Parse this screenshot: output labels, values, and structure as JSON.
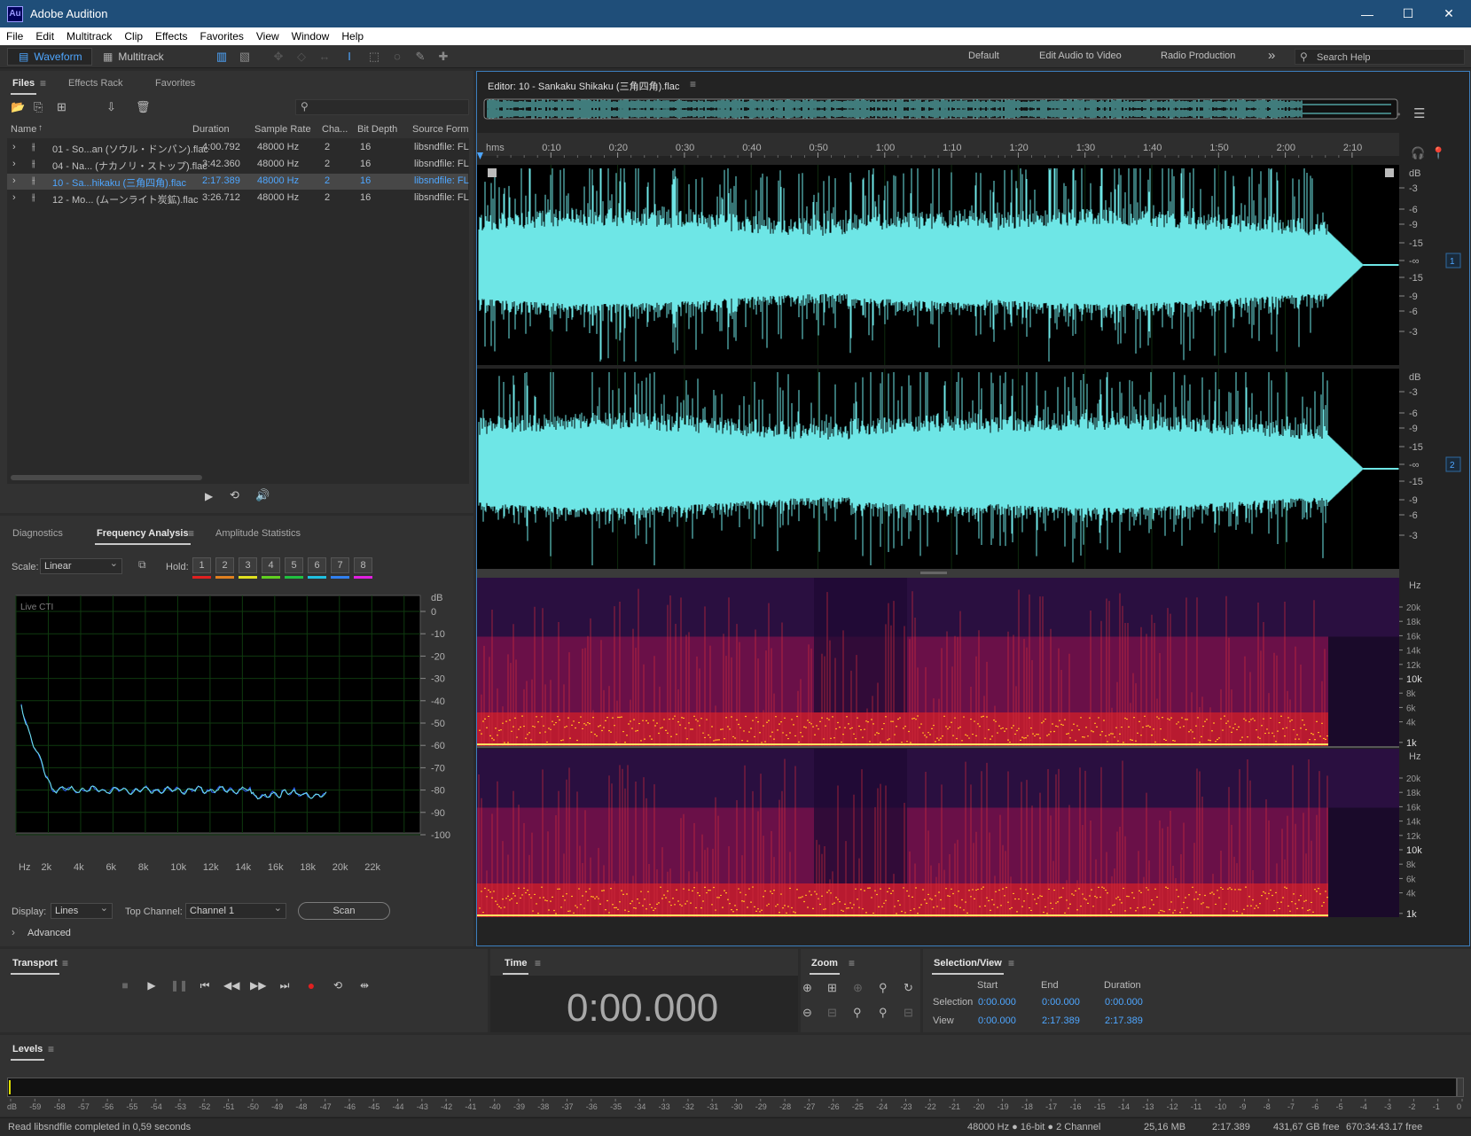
{
  "window": {
    "title": "Adobe Audition",
    "logo": "Au",
    "minimize": "—",
    "maximize": "☐",
    "close": "✕"
  },
  "menu": [
    "File",
    "Edit",
    "Multitrack",
    "Clip",
    "Effects",
    "Favorites",
    "View",
    "Window",
    "Help"
  ],
  "toolbar": {
    "waveform_label": "Waveform",
    "multitrack_label": "Multitrack",
    "workspaces": [
      "Default",
      "Edit Audio to Video",
      "Radio Production"
    ],
    "more": "»",
    "search_placeholder": "Search Help"
  },
  "files_panel": {
    "tabs": [
      "Files",
      "Effects Rack",
      "Favorites"
    ],
    "columns": [
      "Name",
      "Duration",
      "Sample Rate",
      "Cha...",
      "Bit Depth",
      "Source Forma"
    ],
    "rows": [
      {
        "name": "01 - So...an (ソウル・ドンパン).flac",
        "duration": "4:00.792",
        "rate": "48000 Hz",
        "ch": "2",
        "bits": "16",
        "src": "libsndfile: FL",
        "selected": false
      },
      {
        "name": "04 - Na... (ナカノリ・ストップ).flac",
        "duration": "3:42.360",
        "rate": "48000 Hz",
        "ch": "2",
        "bits": "16",
        "src": "libsndfile: FL",
        "selected": false
      },
      {
        "name": "10 - Sa...hikaku (三角四角).flac",
        "duration": "2:17.389",
        "rate": "48000 Hz",
        "ch": "2",
        "bits": "16",
        "src": "libsndfile: FL",
        "selected": true
      },
      {
        "name": "12 - Mo... (ムーンライト炭鉱).flac",
        "duration": "3:26.712",
        "rate": "48000 Hz",
        "ch": "2",
        "bits": "16",
        "src": "libsndfile: FL",
        "selected": false
      }
    ]
  },
  "analysis_panel": {
    "tabs": [
      "Diagnostics",
      "Frequency Analysis",
      "Amplitude Statistics"
    ],
    "scale_label": "Scale:",
    "scale_value": "Linear",
    "hold_label": "Hold:",
    "hold_buttons": [
      "1",
      "2",
      "3",
      "4",
      "5",
      "6",
      "7",
      "8"
    ],
    "hold_colors": [
      "#e02020",
      "#e08020",
      "#e0e020",
      "#60d020",
      "#20c040",
      "#20c0e0",
      "#3080f0",
      "#e020e0"
    ],
    "live_cti": "Live CTI",
    "db_unit": "dB",
    "db_ticks": [
      "0",
      "-10",
      "-20",
      "-30",
      "-40",
      "-50",
      "-60",
      "-70",
      "-80",
      "-90",
      "-100"
    ],
    "hz_ticks": [
      "Hz",
      "2k",
      "4k",
      "6k",
      "8k",
      "10k",
      "12k",
      "14k",
      "16k",
      "18k",
      "20k",
      "22k"
    ],
    "display_label": "Display:",
    "display_value": "Lines",
    "top_channel_label": "Top Channel:",
    "top_channel_value": "Channel 1",
    "scan_label": "Scan",
    "advanced_label": "Advanced"
  },
  "editor": {
    "title": "Editor: 10 - Sankaku Shikaku (三角四角).flac",
    "ruler_unit": "hms",
    "ruler_ticks": [
      "0:10",
      "0:20",
      "0:30",
      "0:40",
      "0:50",
      "1:00",
      "1:10",
      "1:20",
      "1:30",
      "1:40",
      "1:50",
      "2:00",
      "2:10"
    ],
    "db_unit": "dB",
    "db_ticks": [
      "-3",
      "-6",
      "-9",
      "-15",
      "-∞",
      "-15",
      "-9",
      "-6",
      "-3"
    ],
    "channels": [
      "1",
      "2"
    ],
    "hz_unit": "Hz",
    "hz_ticks": [
      "20k",
      "18k",
      "16k",
      "14k",
      "12k",
      "10k",
      "8k",
      "6k",
      "4k",
      "1k"
    ]
  },
  "transport": {
    "title": "Transport"
  },
  "time": {
    "title": "Time",
    "value": "0:00.000"
  },
  "zoom": {
    "title": "Zoom"
  },
  "selection": {
    "title": "Selection/View",
    "headers": [
      "Start",
      "End",
      "Duration"
    ],
    "rows": [
      {
        "label": "Selection",
        "start": "0:00.000",
        "end": "0:00.000",
        "duration": "0:00.000"
      },
      {
        "label": "View",
        "start": "0:00.000",
        "end": "2:17.389",
        "duration": "2:17.389"
      }
    ]
  },
  "levels": {
    "title": "Levels",
    "scale": [
      "dB",
      "-59",
      "-58",
      "-57",
      "-56",
      "-55",
      "-54",
      "-53",
      "-52",
      "-51",
      "-50",
      "-49",
      "-48",
      "-47",
      "-46",
      "-45",
      "-44",
      "-43",
      "-42",
      "-41",
      "-40",
      "-39",
      "-38",
      "-37",
      "-36",
      "-35",
      "-34",
      "-33",
      "-32",
      "-31",
      "-30",
      "-29",
      "-28",
      "-27",
      "-26",
      "-25",
      "-24",
      "-23",
      "-22",
      "-21",
      "-20",
      "-19",
      "-18",
      "-17",
      "-16",
      "-15",
      "-14",
      "-13",
      "-12",
      "-11",
      "-10",
      "-9",
      "-8",
      "-7",
      "-6",
      "-5",
      "-4",
      "-3",
      "-2",
      "-1",
      "0"
    ]
  },
  "status": {
    "message": "Read libsndfile completed in 0,59 seconds",
    "format": "48000 Hz ● 16-bit ● 2 Channel",
    "size": "25,16 MB",
    "duration": "2:17.389",
    "free": "431,67 GB free",
    "free_time": "670:34:43.17 free"
  },
  "colors": {
    "waveform": "#6ee6e6",
    "accent": "#4ea6ff",
    "titlebar": "#1f4e79"
  }
}
